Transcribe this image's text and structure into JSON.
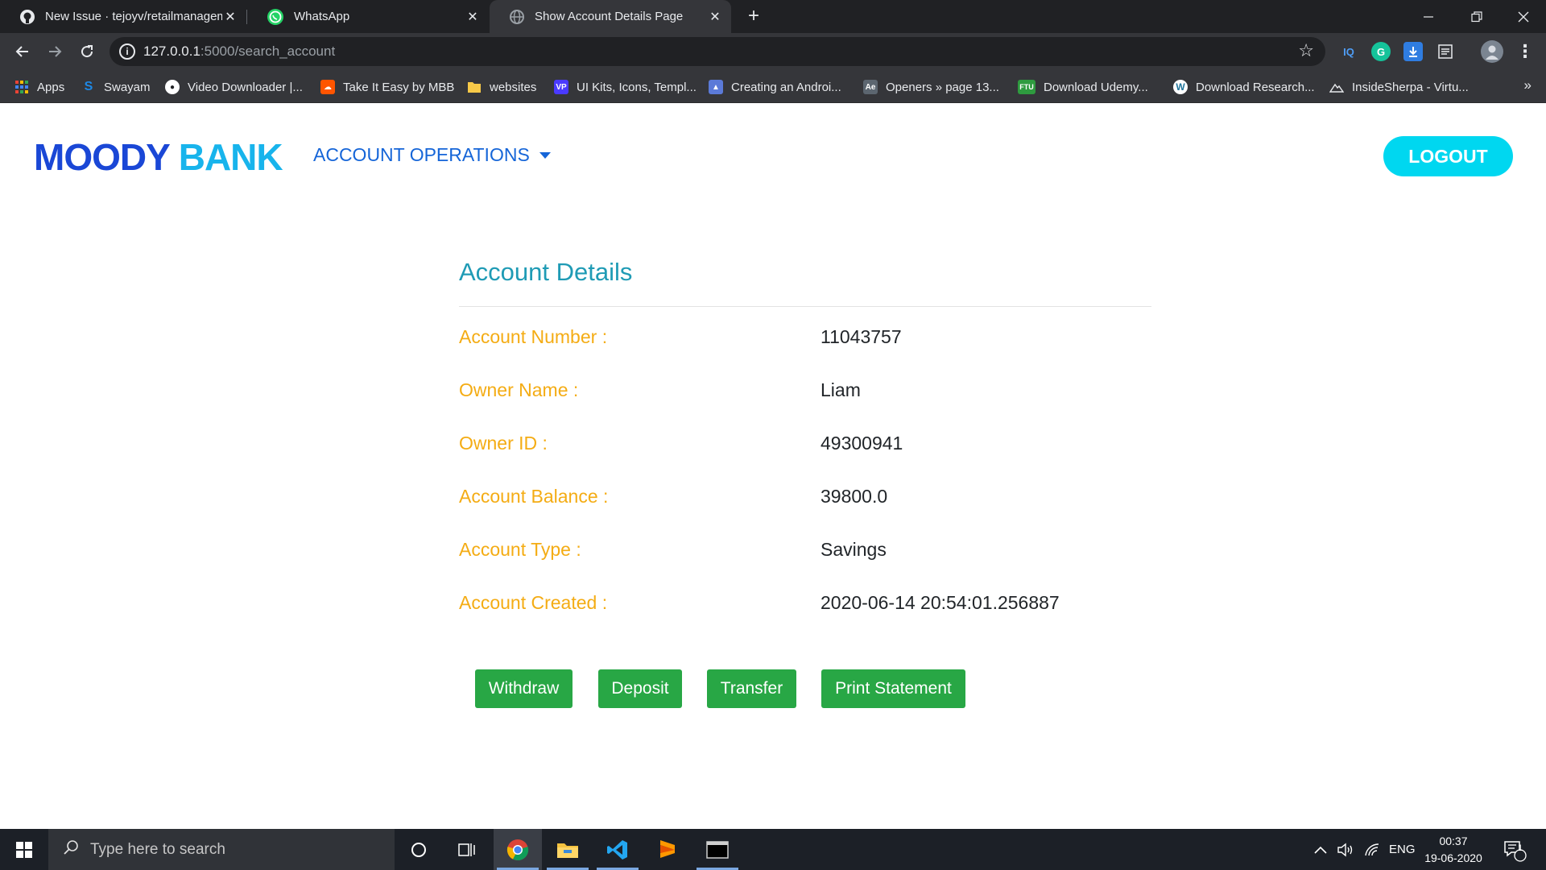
{
  "browser": {
    "tabs": [
      {
        "title": "New Issue · tejoyv/retailmanagement",
        "icon": "github-icon"
      },
      {
        "title": "WhatsApp",
        "icon": "whatsapp-icon"
      },
      {
        "title": "Show Account Details Page",
        "icon": "globe-icon",
        "active": true
      }
    ],
    "url_host": "127.0.0.1",
    "url_path": ":5000/search_account",
    "bookmarks": [
      "Apps",
      "Swayam",
      "Video Downloader |...",
      "Take It Easy by MBB",
      "websites",
      "UI Kits, Icons, Templ...",
      "Creating an Androi...",
      "Openers » page 13...",
      "Download Udemy...",
      "Download Research...",
      "InsideSherpa - Virtu..."
    ],
    "bookmark_more": "»",
    "ext_labels": {
      "iq": "IQ",
      "grammarly": "G",
      "vp": "VP",
      "ftu": "FTU"
    }
  },
  "navbar": {
    "brand_part1": "MOODY",
    "brand_part2": "BANK",
    "menu_label": "ACCOUNT OPERATIONS",
    "logout_label": "LOGOUT"
  },
  "details": {
    "title": "Account Details",
    "rows": [
      {
        "label": "Account Number :",
        "value": "11043757"
      },
      {
        "label": "Owner Name :",
        "value": "Liam"
      },
      {
        "label": "Owner ID :",
        "value": "49300941"
      },
      {
        "label": "Account Balance :",
        "value": "39800.0"
      },
      {
        "label": "Account Type :",
        "value": "Savings"
      },
      {
        "label": "Account Created :",
        "value": "2020-06-14 20:54:01.256887"
      }
    ]
  },
  "actions": {
    "withdraw": "Withdraw",
    "deposit": "Deposit",
    "transfer": "Transfer",
    "print_statement": "Print Statement"
  },
  "taskbar": {
    "search_placeholder": "Type here to search",
    "language": "ENG",
    "time": "00:37",
    "date": "19-06-2020",
    "notification_count": "1"
  },
  "colors": {
    "brand_dark": "#1a47d6",
    "brand_light": "#18b4ec",
    "label": "#f4ac14",
    "title": "#1f9bb5",
    "action_button": "#28a745",
    "logout": "#00d7f0"
  }
}
